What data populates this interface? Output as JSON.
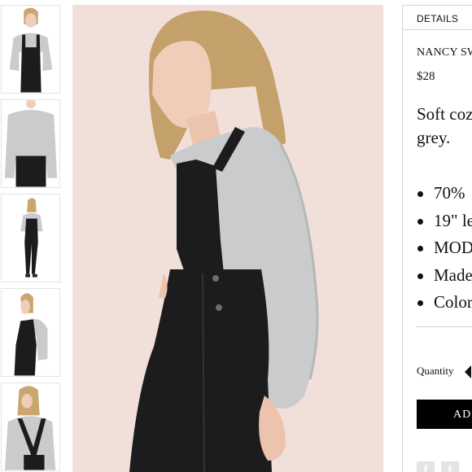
{
  "details_tab": {
    "label": "DETAILS"
  },
  "product": {
    "name": "NANCY SWEATER",
    "price": "$28",
    "description_lines": [
      "Soft cozy",
      "grey."
    ],
    "bullets": [
      "70%",
      "19\" le",
      "MOD",
      "Made",
      "Color"
    ]
  },
  "purchase": {
    "quantity_label": "Quantity",
    "add_button_label": "ADD TO BAG"
  },
  "share": {
    "facebook_glyph": "f",
    "twitter_glyph": "t"
  },
  "colors": {
    "backdrop": "#f1dfd9",
    "sweater": "#c9cbcd",
    "overalls": "#1c1c1e",
    "button": "#000000"
  }
}
